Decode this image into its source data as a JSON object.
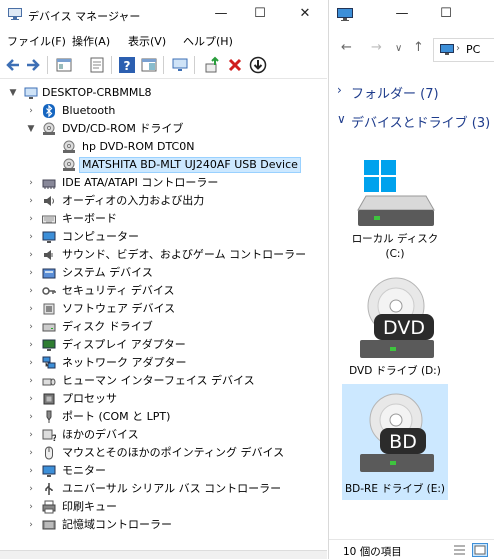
{
  "device_manager": {
    "title": "デバイス マネージャー",
    "window_controls": {
      "minimize": "—",
      "maximize": "☐",
      "close": "✕"
    },
    "menu": [
      "ファイル(F)",
      "操作(A)",
      "表示(V)",
      "ヘルプ(H)"
    ],
    "tree": {
      "root": "DESKTOP-CRBMML8",
      "items": [
        "Bluetooth",
        "DVD/CD-ROM ドライブ",
        "hp DVD-ROM DTC0N",
        "MATSHITA BD-MLT UJ240AF USB Device",
        "IDE ATA/ATAPI コントローラー",
        "オーディオの入力および出力",
        "キーボード",
        "コンピューター",
        "サウンド、ビデオ、およびゲーム コントローラー",
        "システム デバイス",
        "セキュリティ デバイス",
        "ソフトウェア デバイス",
        "ディスク ドライブ",
        "ディスプレイ アダプター",
        "ネットワーク アダプター",
        "ヒューマン インターフェイス デバイス",
        "プロセッサ",
        "ポート (COM と LPT)",
        "ほかのデバイス",
        "マウスとそのほかのポインティング デバイス",
        "モニター",
        "ユニバーサル シリアル バス コントローラー",
        "印刷キュー",
        "記憶域コントローラー"
      ]
    }
  },
  "explorer": {
    "window_controls": {
      "minimize": "—",
      "maximize": "☐"
    },
    "address": "PC",
    "groups": {
      "folders": "フォルダー (7)",
      "devices": "デバイスとドライブ (3)"
    },
    "drives": [
      {
        "label1": "ローカル ディスク",
        "label2": "(C:)",
        "badge": ""
      },
      {
        "label1": "DVD ドライブ (D:)",
        "label2": "",
        "badge": "DVD"
      },
      {
        "label1": "BD-RE ドライブ (E:)",
        "label2": "",
        "badge": "BD"
      }
    ],
    "status": "10 個の項目"
  },
  "colors": {
    "selection": "#cce8ff",
    "group_text": "#1e3c8c",
    "windows_blue": "#00a2ed"
  }
}
